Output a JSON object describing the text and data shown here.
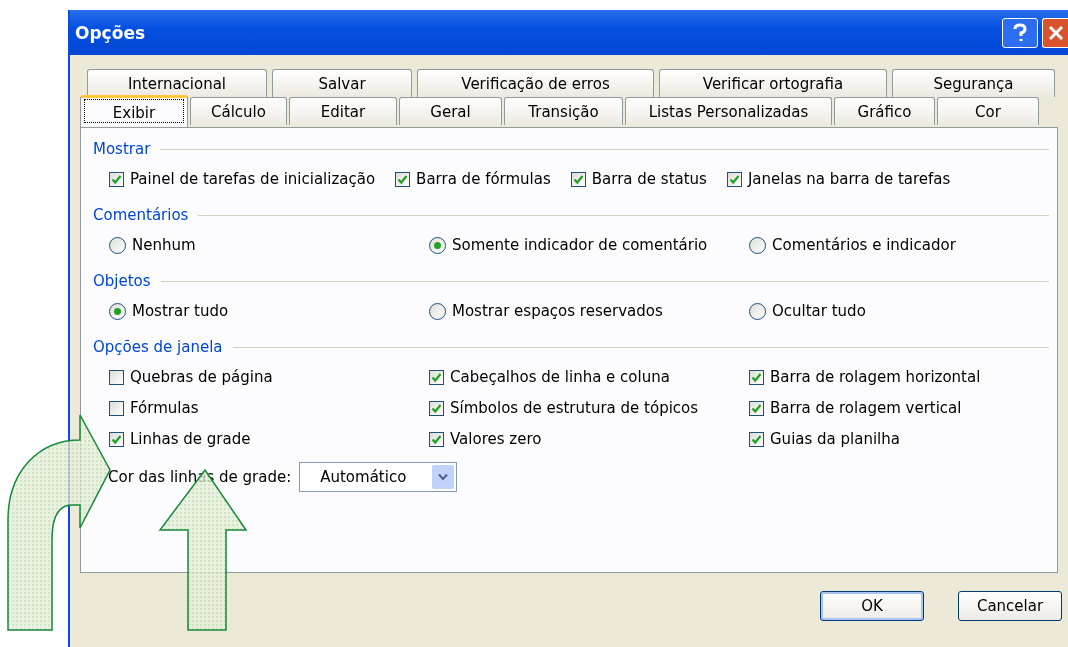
{
  "window": {
    "title": "Opções"
  },
  "tabs_row_1": [
    {
      "label": "Internacional",
      "selected": false
    },
    {
      "label": "Salvar",
      "selected": false
    },
    {
      "label": "Verificação de erros",
      "selected": false
    },
    {
      "label": "Verificar ortografia",
      "selected": false
    },
    {
      "label": "Segurança",
      "selected": false
    }
  ],
  "tabs_row_2": [
    {
      "label": "Exibir",
      "selected": true
    },
    {
      "label": "Cálculo",
      "selected": false
    },
    {
      "label": "Editar",
      "selected": false
    },
    {
      "label": "Geral",
      "selected": false
    },
    {
      "label": "Transição",
      "selected": false
    },
    {
      "label": "Listas Personalizadas",
      "selected": false
    },
    {
      "label": "Gráfico",
      "selected": false
    },
    {
      "label": "Cor",
      "selected": false
    }
  ],
  "sections": [
    {
      "title": "Mostrar",
      "kind": "inline",
      "items": [
        {
          "kind": "checkbox",
          "label": "Painel de tarefas de inicialização",
          "checked": true
        },
        {
          "kind": "checkbox",
          "label": "Barra de fórmulas",
          "checked": true
        },
        {
          "kind": "checkbox",
          "label": "Barra de status",
          "checked": true
        },
        {
          "kind": "checkbox",
          "label": "Janelas na barra de tarefas",
          "checked": true
        }
      ]
    },
    {
      "title": "Comentários",
      "kind": "grid",
      "items": [
        {
          "kind": "radio",
          "label": "Nenhum",
          "selected": false
        },
        {
          "kind": "radio",
          "label": "Somente indicador de comentário",
          "selected": true
        },
        {
          "kind": "radio",
          "label": "Comentários e indicador",
          "selected": false
        }
      ]
    },
    {
      "title": "Objetos",
      "kind": "grid",
      "items": [
        {
          "kind": "radio",
          "label": "Mostrar tudo",
          "selected": true
        },
        {
          "kind": "radio",
          "label": "Mostrar espaços reservados",
          "selected": false
        },
        {
          "kind": "radio",
          "label": "Ocultar tudo",
          "selected": false
        }
      ]
    },
    {
      "title": "Opções de janela",
      "kind": "grid",
      "items": [
        {
          "kind": "checkbox",
          "label": "Quebras de página",
          "checked": false
        },
        {
          "kind": "checkbox",
          "label": "Cabeçalhos de linha e coluna",
          "checked": true
        },
        {
          "kind": "checkbox",
          "label": "Barra de rolagem horizontal",
          "checked": true
        },
        {
          "kind": "checkbox",
          "label": "Fórmulas",
          "checked": false
        },
        {
          "kind": "checkbox",
          "label": "Símbolos de estrutura de tópicos",
          "checked": true
        },
        {
          "kind": "checkbox",
          "label": "Barra de rolagem vertical",
          "checked": true
        },
        {
          "kind": "checkbox",
          "label": "Linhas de grade",
          "checked": true
        },
        {
          "kind": "checkbox",
          "label": "Valores zero",
          "checked": true
        },
        {
          "kind": "checkbox",
          "label": "Guias da planilha",
          "checked": true
        }
      ],
      "select": {
        "label": "Cor das linhas de grade:",
        "value": "Automático"
      }
    }
  ],
  "buttons": [
    "OK",
    "Cancelar"
  ]
}
